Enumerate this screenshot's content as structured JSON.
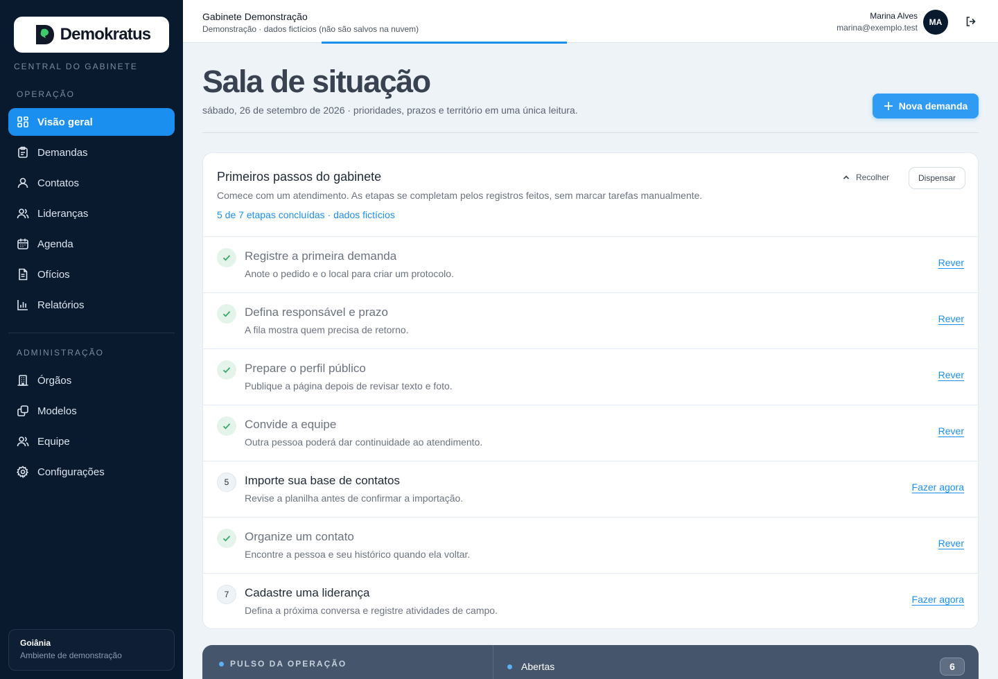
{
  "brand": {
    "name": "Demokratus",
    "tagline": "CENTRAL DO GABINETE"
  },
  "sidebar": {
    "section_operation": "OPERAÇÃO",
    "section_admin": "ADMINISTRAÇÃO",
    "items": [
      {
        "label": "Visão geral",
        "icon": "grid-icon",
        "active": true
      },
      {
        "label": "Demandas",
        "icon": "clipboard-icon"
      },
      {
        "label": "Contatos",
        "icon": "user-icon"
      },
      {
        "label": "Lideranças",
        "icon": "users-icon"
      },
      {
        "label": "Agenda",
        "icon": "calendar-icon"
      },
      {
        "label": "Ofícios",
        "icon": "document-icon"
      },
      {
        "label": "Relatórios",
        "icon": "bar-chart-icon"
      }
    ],
    "admin_items": [
      {
        "label": "Órgãos",
        "icon": "building-icon"
      },
      {
        "label": "Modelos",
        "icon": "copy-icon"
      },
      {
        "label": "Equipe",
        "icon": "users-icon"
      },
      {
        "label": "Configurações",
        "icon": "gear-icon"
      }
    ],
    "location": {
      "city": "Goiânia",
      "env": "Ambiente de demonstração"
    }
  },
  "topbar": {
    "title": "Gabinete Demonstração",
    "subtitle": "Demonstração · dados fictícios (não são salvos na nuvem)",
    "user_name": "Marina Alves",
    "user_email": "marina@exemplo.test",
    "avatar_initials": "MA"
  },
  "main": {
    "title": "Sala de situação",
    "subtitle": "sábado, 26 de setembro de 2026 · prioridades, prazos e território em uma única leitura.",
    "new_button": "Nova demanda"
  },
  "onboarding": {
    "title": "Primeiros passos do gabinete",
    "description": "Comece com um atendimento. As etapas se completam pelos registros feitos, sem marcar tarefas manualmente.",
    "progress": "5 de 7 etapas concluídas · dados fictícios",
    "collapse_label": "Recolher",
    "dismiss_label": "Dispensar",
    "steps": [
      {
        "title": "Registre a primeira demanda",
        "desc": "Anote o pedido e o local para criar um protocolo.",
        "done": true,
        "action": "Rever"
      },
      {
        "title": "Defina responsável e prazo",
        "desc": "A fila mostra quem precisa de retorno.",
        "done": true,
        "action": "Rever"
      },
      {
        "title": "Prepare o perfil público",
        "desc": "Publique a página depois de revisar texto e foto.",
        "done": true,
        "action": "Rever"
      },
      {
        "title": "Convide a equipe",
        "desc": "Outra pessoa poderá dar continuidade ao atendimento.",
        "done": true,
        "action": "Rever"
      },
      {
        "title": "Importe sua base de contatos",
        "desc": "Revise a planilha antes de confirmar a importação.",
        "done": false,
        "number": "5",
        "action": "Fazer agora"
      },
      {
        "title": "Organize um contato",
        "desc": "Encontre a pessoa e seu histórico quando ela voltar.",
        "done": true,
        "action": "Rever"
      },
      {
        "title": "Cadastre uma liderança",
        "desc": "Defina a próxima conversa e registre atividades de campo.",
        "done": false,
        "number": "7",
        "action": "Fazer agora"
      }
    ]
  },
  "pulse": {
    "label": "PULSO DA OPERAÇÃO",
    "open_label": "Abertas",
    "open_count": "6"
  },
  "colors": {
    "accent": "#1b8ff0",
    "sidebar_bg": "#0a1a2e",
    "done_bg": "#e4f4ea",
    "done_check": "#3aa86b"
  }
}
